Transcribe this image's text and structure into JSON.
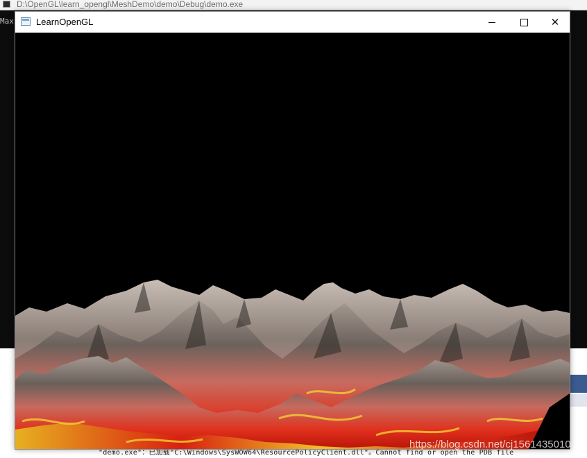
{
  "console": {
    "title": "D:\\OpenGL\\learn_opengl\\MeshDemo\\demo\\Debug\\demo.exe",
    "text_fragment": "Max"
  },
  "gl_window": {
    "title": "LearnOpenGL",
    "controls": {
      "minimize": "minimize",
      "maximize": "maximize",
      "close": "✕"
    },
    "scene": "terrain-mesh"
  },
  "output": {
    "line": "\"demo.exe\"：已加载\"C:\\Windows\\SysWOW64\\ResourcePolicyClient.dll\"。Cannot find or open the PDB file"
  },
  "watermark": "https://blog.csdn.net/cj1561435010",
  "colors": {
    "console_bg": "#0c0c0c",
    "gl_bg": "#000000",
    "rock_light": "#b9aea6",
    "rock_dark": "#3a3430",
    "lava_red": "#d8241a",
    "lava_yellow": "#f0c020"
  }
}
